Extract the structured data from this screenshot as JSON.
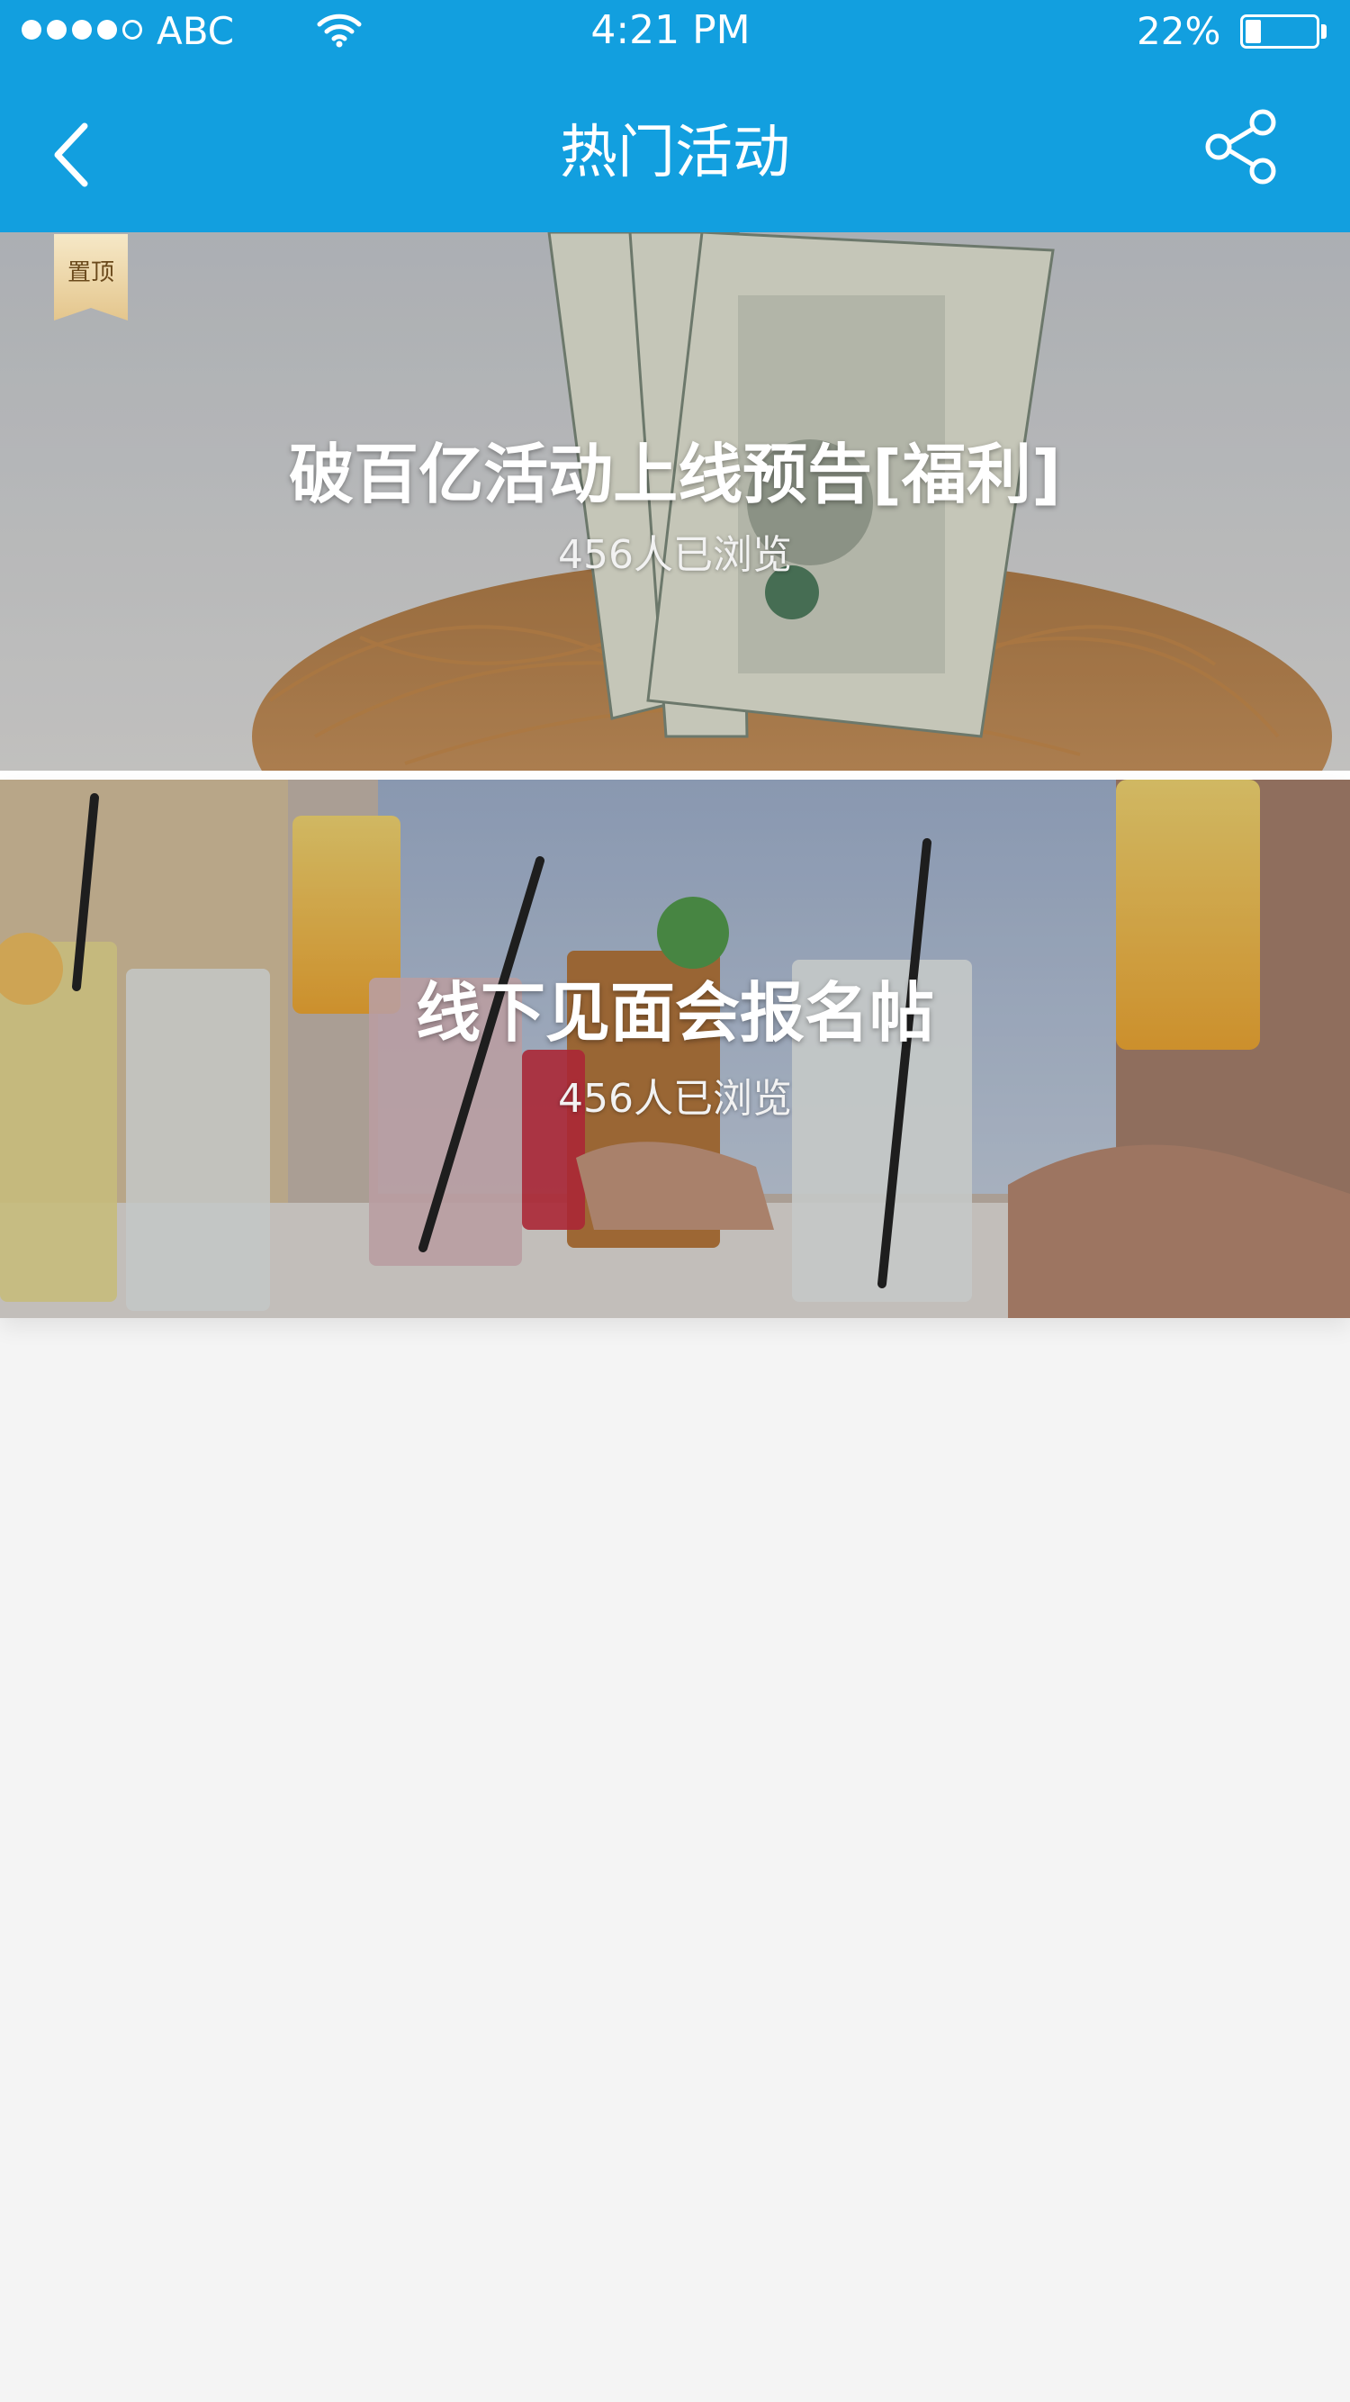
{
  "status_bar": {
    "carrier": "ABC",
    "time": "4:21 PM",
    "battery_percent": "22%",
    "battery_level": 0.22,
    "signal_bars_filled": 4,
    "signal_bars_total": 5
  },
  "nav": {
    "title": "热门活动",
    "back_icon": "chevron-left-icon",
    "share_icon": "share-icon"
  },
  "activities": [
    {
      "title": "破百亿活动上线预告[福利]",
      "views": "456人已浏览",
      "pinned": true,
      "pin_label": "置顶",
      "image": "money-nest-photo"
    },
    {
      "title": "线下见面会报名帖",
      "views": "456人已浏览",
      "pinned": false,
      "image": "drinks-table-photo"
    }
  ],
  "colors": {
    "brand_blue": "#129fdf",
    "page_background": "#f4f4f4",
    "pin_gold": "#e9cf9c"
  }
}
